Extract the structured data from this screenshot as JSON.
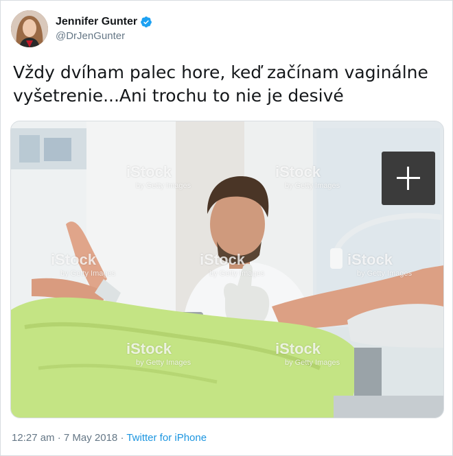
{
  "author": {
    "name": "Jennifer Gunter",
    "handle": "@DrJenGunter",
    "verified": true,
    "avatar_icon": "profile-photo"
  },
  "tweet": {
    "text_line1": "Vždy dvíham palec hore, keď začínam vaginálne",
    "text_line2": "vyšetrenie...Ani trochu to nie je desivé"
  },
  "media": {
    "description_icon": "stock-photo",
    "watermark_main": "iStock",
    "watermark_sub": "by Getty Images",
    "expand_icon": "plus-icon"
  },
  "meta": {
    "time": "12:27 am",
    "separator": " · ",
    "date": "7 May 2018",
    "source": "Twitter for iPhone"
  },
  "colors": {
    "link": "#1b95e0",
    "secondary_text": "#657786",
    "verified": "#1da1f2"
  }
}
